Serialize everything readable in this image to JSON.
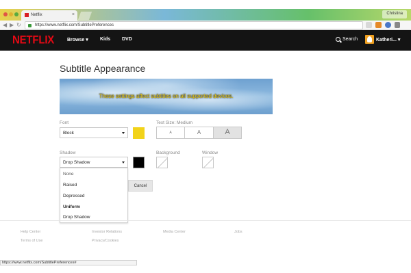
{
  "browser": {
    "tab_title": "Netflix",
    "tab_close": "×",
    "profile_name": "Christina",
    "url": "https://www.netflix.com/SubtitlePreferences",
    "status_url": "https://www.netflix.com/SubtitlePreferences#"
  },
  "header": {
    "logo": "NETFLIX",
    "nav": [
      {
        "label": "Browse ▾"
      },
      {
        "label": "Kids"
      },
      {
        "label": "DVD"
      }
    ],
    "search_label": "Search",
    "profile_label": "Katheri... ▾"
  },
  "page": {
    "title": "Subtitle Appearance",
    "preview_text": "These settings affect subtitles on all supported devices."
  },
  "form": {
    "font": {
      "label": "Font",
      "value": "Block",
      "color": "#f2d31a"
    },
    "text_size": {
      "label": "Text Size: Medium",
      "options": [
        "A",
        "A",
        "A"
      ],
      "selected_index": 2
    },
    "shadow": {
      "label": "Shadow",
      "value": "Drop Shadow",
      "color": "#000000"
    },
    "background": {
      "label": "Background"
    },
    "window": {
      "label": "Window"
    },
    "shadow_options": [
      "None",
      "Raised",
      "Depressed",
      "Uniform",
      "Drop Shadow"
    ],
    "cancel_label": "Cancel"
  },
  "footer": {
    "links": [
      "Help Center",
      "Investor Relations",
      "Media Center",
      "Jobs",
      "Terms of Use",
      "Privacy/Cookies"
    ]
  }
}
